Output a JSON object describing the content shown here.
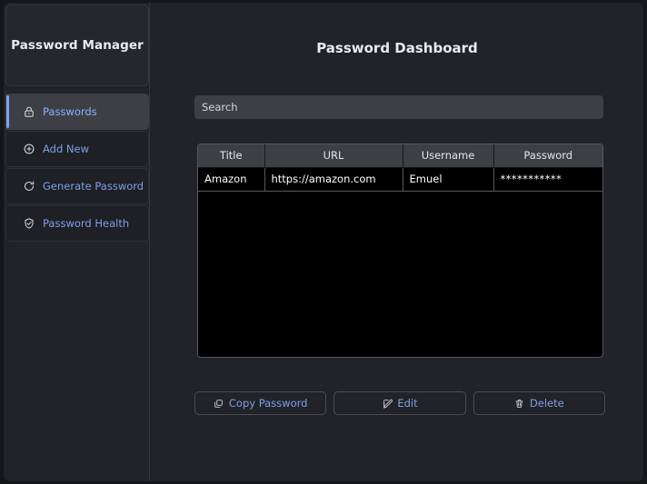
{
  "app": {
    "window_title": "Password Manager"
  },
  "sidebar": {
    "title": "Password Manager",
    "items": [
      {
        "label": "Passwords",
        "icon": "lock-icon",
        "active": true
      },
      {
        "label": "Add New",
        "icon": "plus-circle-icon",
        "active": false
      },
      {
        "label": "Generate Password",
        "icon": "refresh-icon",
        "active": false
      },
      {
        "label": "Password Health",
        "icon": "shield-check-icon",
        "active": false
      }
    ]
  },
  "main": {
    "page_title": "Password Dashboard",
    "search": {
      "placeholder": "Search",
      "value": ""
    },
    "table": {
      "columns": [
        "Title",
        "URL",
        "Username",
        "Password"
      ],
      "rows": [
        {
          "title": "Amazon",
          "url": "https://amazon.com",
          "username": "Emuel",
          "password": "***********"
        }
      ]
    },
    "actions": [
      {
        "label": "Copy Password",
        "icon": "copy-icon"
      },
      {
        "label": "Edit",
        "icon": "edit-pencil-icon"
      },
      {
        "label": "Delete",
        "icon": "trash-icon"
      }
    ]
  },
  "colors": {
    "page_background": "#15161a",
    "window_background": "#212328",
    "sidebar_item": "#1e2025",
    "sidebar_item_active": "#3d3f44",
    "accent_blue": "#7aa2f7",
    "link_text": "#7f9fe8",
    "table_header": "#3c3f45",
    "table_body": "#000000",
    "search_field": "#3c3f45"
  }
}
